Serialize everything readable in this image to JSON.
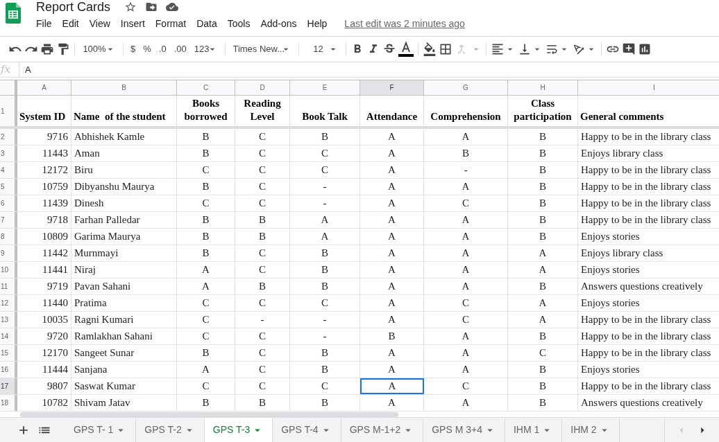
{
  "document": {
    "title": "Report Cards",
    "last_edit": "Last edit was 2 minutes ago"
  },
  "menu": [
    "File",
    "Edit",
    "View",
    "Insert",
    "Format",
    "Data",
    "Tools",
    "Add-ons",
    "Help"
  ],
  "toolbar": {
    "zoom": "100%",
    "currency": "$",
    "percent": "%",
    "decrease_decimals": ".0",
    "increase_decimals": ".00",
    "number_format": "123",
    "font": "Times New...",
    "font_size": "12"
  },
  "formula_bar": {
    "fx": "fx",
    "value": "A"
  },
  "grid": {
    "column_letters": [
      {
        "label": "A",
        "selected": false
      },
      {
        "label": "B",
        "selected": false
      },
      {
        "label": "C",
        "selected": false
      },
      {
        "label": "D",
        "selected": false
      },
      {
        "label": "E",
        "selected": false
      },
      {
        "label": "F",
        "selected": true
      },
      {
        "label": "G",
        "selected": false
      },
      {
        "label": "H",
        "selected": false
      },
      {
        "label": "I",
        "selected": false
      }
    ],
    "header_row": {
      "number": "1",
      "cells": [
        "System ID",
        "Name  of the student",
        "Books borrowed",
        "Reading Level",
        "Book Talk",
        "Attendance",
        "Comprehension",
        "Class participation",
        "General comments"
      ]
    },
    "rows": [
      {
        "number": "2",
        "selected": false,
        "cells": [
          "9716",
          "Abhishek Kamle",
          "B",
          "C",
          "B",
          "A",
          "A",
          "B",
          "Happy to be in the library class"
        ]
      },
      {
        "number": "3",
        "selected": false,
        "cells": [
          "11443",
          "Aman",
          "B",
          "C",
          "C",
          "A",
          "B",
          "B",
          "Enjoys library class"
        ]
      },
      {
        "number": "4",
        "selected": false,
        "cells": [
          "12172",
          "Biru",
          "C",
          "C",
          "C",
          "A",
          "-",
          "B",
          "Happy to be in the library class"
        ]
      },
      {
        "number": "5",
        "selected": false,
        "cells": [
          "10759",
          "Dibyanshu Maurya",
          "B",
          "C",
          "-",
          "A",
          "A",
          "B",
          "Happy to be in the library class"
        ]
      },
      {
        "number": "6",
        "selected": false,
        "cells": [
          "11439",
          "Dinesh",
          "C",
          "C",
          "-",
          "A",
          "C",
          "B",
          "Happy to be in the library class"
        ]
      },
      {
        "number": "7",
        "selected": false,
        "cells": [
          "9718",
          "Farhan Palledar",
          "B",
          "B",
          "A",
          "A",
          "A",
          "B",
          "Happy to be in the library class"
        ]
      },
      {
        "number": "8",
        "selected": false,
        "cells": [
          "10809",
          "Garima Maurya",
          "B",
          "B",
          "A",
          "A",
          "A",
          "B",
          "Enjoys stories"
        ]
      },
      {
        "number": "9",
        "selected": false,
        "cells": [
          "11442",
          "Murnmayi",
          "B",
          "C",
          "B",
          "A",
          "A",
          "A",
          "Enjoys library class"
        ]
      },
      {
        "number": "10",
        "selected": false,
        "cells": [
          "11441",
          "Niraj",
          "A",
          "C",
          "B",
          "A",
          "A",
          "A",
          "Enjoys stories"
        ]
      },
      {
        "number": "11",
        "selected": false,
        "cells": [
          "9719",
          "Pavan Sahani",
          "A",
          "B",
          "B",
          "A",
          "A",
          "B",
          "Answers questions creatively"
        ]
      },
      {
        "number": "12",
        "selected": false,
        "cells": [
          "11440",
          "Pratima",
          "C",
          "C",
          "C",
          "A",
          "C",
          "A",
          "Enjoys stories"
        ]
      },
      {
        "number": "13",
        "selected": false,
        "cells": [
          "10035",
          "Ragni Kumari",
          "C",
          "-",
          "-",
          "A",
          "C",
          "A",
          "Happy to be in the library class"
        ]
      },
      {
        "number": "14",
        "selected": false,
        "cells": [
          "9720",
          "Ramlakhan Sahani",
          "C",
          "C",
          "-",
          "B",
          "A",
          "B",
          "Happy to be in the library class"
        ]
      },
      {
        "number": "15",
        "selected": false,
        "cells": [
          "12170",
          "Sangeet Sunar",
          "B",
          "C",
          "B",
          "A",
          "A",
          "C",
          "Happy to be in the library class"
        ]
      },
      {
        "number": "16",
        "selected": false,
        "cells": [
          "11444",
          "Sanjana",
          "A",
          "C",
          "B",
          "A",
          "A",
          "B",
          "Enjoys stories"
        ]
      },
      {
        "number": "17",
        "selected": true,
        "cells": [
          "9807",
          "Saswat Kumar",
          "C",
          "C",
          "C",
          "A",
          "C",
          "B",
          "Happy to be in the library class"
        ]
      },
      {
        "number": "18",
        "selected": false,
        "cells": [
          "10782",
          "Shivam Jatav",
          "B",
          "B",
          "B",
          "A",
          "A",
          "B",
          "Answers questions creatively"
        ]
      }
    ]
  },
  "sheet_tabs": [
    {
      "label": "GPS T- 1",
      "selected": false
    },
    {
      "label": "GPS T-2",
      "selected": false
    },
    {
      "label": "GPS T-3",
      "selected": true
    },
    {
      "label": "GPS T-4",
      "selected": false
    },
    {
      "label": "GPS M-1+2",
      "selected": false
    },
    {
      "label": "GPS M 3+4",
      "selected": false
    },
    {
      "label": "IHM 1",
      "selected": false
    },
    {
      "label": "IHM 2",
      "selected": false
    }
  ]
}
